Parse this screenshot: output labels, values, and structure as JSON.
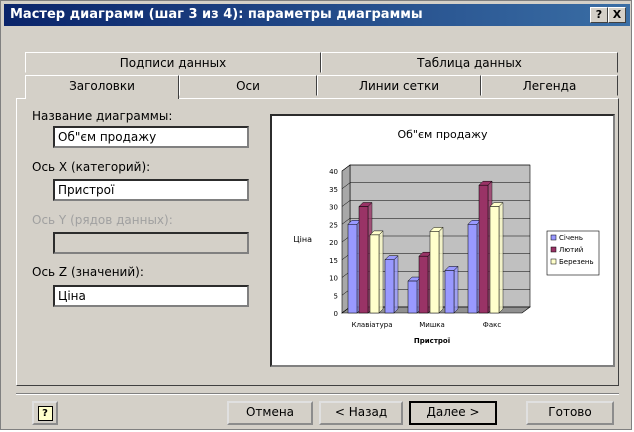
{
  "window": {
    "title": "Мастер диаграмм (шаг 3 из 4): параметры диаграммы",
    "help": "?",
    "close": "X"
  },
  "tabs_back": [
    "Подписи данных",
    "Таблица данных"
  ],
  "tabs_front": [
    "Заголовки",
    "Оси",
    "Линии сетки",
    "Легенда"
  ],
  "form": {
    "chart_title_label": "Название диаграммы:",
    "chart_title_value": "Об\"єм продажу",
    "x_axis_label": "Ось X (категорий):",
    "x_axis_value": "Пристрої",
    "y_axis_label": "Ось Y (рядов данных):",
    "y_axis_value": "",
    "z_axis_label": "Ось Z (значений):",
    "z_axis_value": "Ціна"
  },
  "buttons": {
    "help_icon": "?",
    "cancel": "Отмена",
    "back": "< Назад",
    "next": "Далее >",
    "finish": "Готово"
  },
  "chart_data": {
    "type": "bar",
    "title": "Об\"єм продажу",
    "xlabel": "Пристрої",
    "ylabel": "Ціна",
    "categories": [
      "Клавіатура",
      "Мишка",
      "Факс"
    ],
    "ylim": [
      0,
      40
    ],
    "yticks": [
      0,
      5,
      10,
      15,
      20,
      25,
      30,
      35,
      40
    ],
    "grid": true,
    "legend": "right",
    "series": [
      {
        "name": "Січень",
        "color": "#9999ff",
        "values": [
          25,
          9,
          25
        ]
      },
      {
        "name": "Лютий",
        "color": "#993366",
        "values": [
          30,
          16,
          36
        ]
      },
      {
        "name": "Березень",
        "color": "#ffffcc",
        "values": [
          22,
          23,
          30
        ]
      }
    ]
  },
  "extra_bars": {
    "color": "#9999ff",
    "values": [
      15,
      12
    ]
  }
}
